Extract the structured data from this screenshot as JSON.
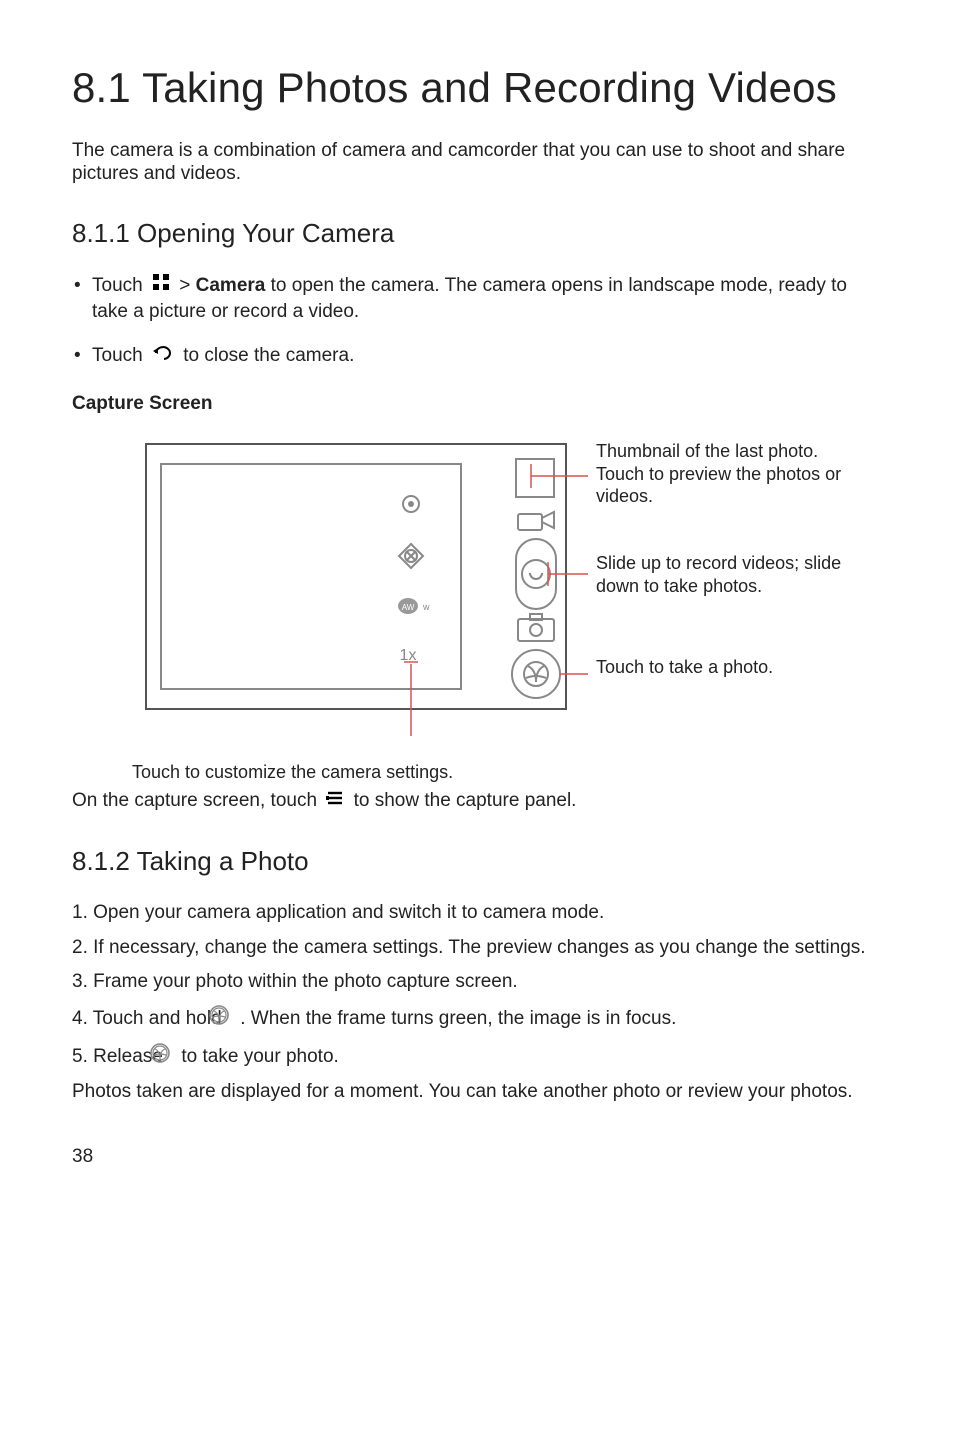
{
  "heading_main": "8.1  Taking Photos and Recording Videos",
  "intro": "The camera is a combination of camera and camcorder that you can use to shoot and share pictures and videos.",
  "sec_811_title": "8.1.1  Opening Your Camera",
  "bullet1_pre": "Touch",
  "bullet1_mid": " > ",
  "bullet1_bold": "Camera",
  "bullet1_post": " to open the camera. The camera opens in landscape mode, ready to take a picture or record a video.",
  "bullet2_pre": "Touch",
  "bullet2_post": " to close the camera.",
  "capture_screen_label": "Capture Screen",
  "callout_thumb": "Thumbnail of the last photo. Touch to preview the photos or videos.",
  "callout_slide": "Slide up to record videos; slide down to take photos.",
  "callout_shutter": "Touch to take a photo.",
  "callout_customize": "Touch to customize the camera settings.",
  "after_diagram_pre": "On the capture screen, touch ",
  "after_diagram_post": " to show the capture panel.",
  "sec_812_title": "8.1.2  Taking a Photo",
  "steps": {
    "s1": "1. Open your camera application and switch it to camera mode.",
    "s2": "2. If necessary, change the camera settings. The preview changes as you change the settings.",
    "s3": "3. Frame your photo within the photo capture screen.",
    "s4_pre": "4. Touch and hold ",
    "s4_post": " . When the frame turns green, the image is in focus.",
    "s5_pre": "5. Release ",
    "s5_post": " to take your photo."
  },
  "conclusion": "Photos taken are displayed for a moment. You can take another photo or review your photos.",
  "page_number": "38",
  "diagram": {
    "zoom_label": "1x",
    "aw_label": "AW"
  }
}
